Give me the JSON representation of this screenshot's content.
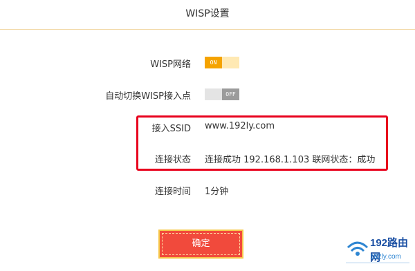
{
  "title": "WISP设置",
  "rows": {
    "wisp_network": {
      "label": "WISP网络",
      "toggle": "ON"
    },
    "auto_switch": {
      "label": "自动切换WISP接入点",
      "toggle": "OFF"
    },
    "ssid": {
      "label": "接入SSID",
      "value": "www.192ly.com"
    },
    "status": {
      "label": "连接状态",
      "value": "连接成功 192.168.1.103 联网状态：成功"
    },
    "time": {
      "label": "连接时间",
      "value": "1分钟"
    }
  },
  "confirm_label": "确定",
  "watermark": {
    "brand": "192路由网",
    "url": "192ly.com",
    "logo_text": "192"
  },
  "colors": {
    "accent": "#f5a300",
    "highlight": "#e8001c",
    "button": "#f14a3c"
  }
}
